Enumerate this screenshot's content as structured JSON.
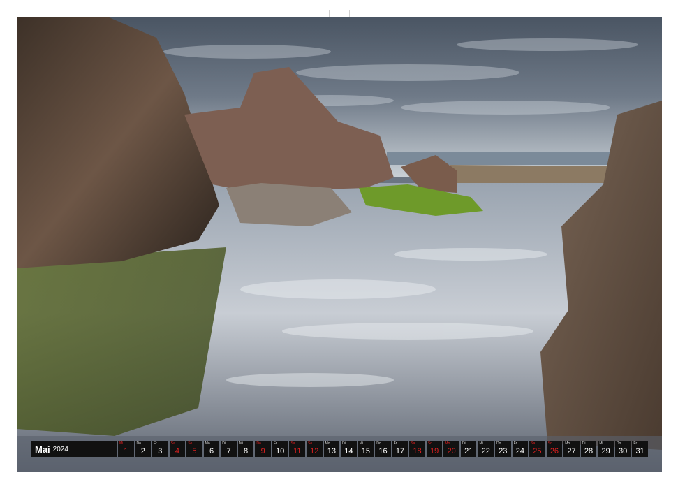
{
  "calendar": {
    "month": "Mai",
    "year": "2024",
    "days": [
      {
        "wd": "Mi",
        "num": "1",
        "red": true
      },
      {
        "wd": "Do",
        "num": "2",
        "red": false
      },
      {
        "wd": "Fr",
        "num": "3",
        "red": false
      },
      {
        "wd": "Sa",
        "num": "4",
        "red": true
      },
      {
        "wd": "So",
        "num": "5",
        "red": true
      },
      {
        "wd": "Mo",
        "num": "6",
        "red": false
      },
      {
        "wd": "Di",
        "num": "7",
        "red": false
      },
      {
        "wd": "Mi",
        "num": "8",
        "red": false
      },
      {
        "wd": "Do",
        "num": "9",
        "red": true
      },
      {
        "wd": "Fr",
        "num": "10",
        "red": false
      },
      {
        "wd": "Sa",
        "num": "11",
        "red": true
      },
      {
        "wd": "So",
        "num": "12",
        "red": true
      },
      {
        "wd": "Mo",
        "num": "13",
        "red": false
      },
      {
        "wd": "Di",
        "num": "14",
        "red": false
      },
      {
        "wd": "Mi",
        "num": "15",
        "red": false
      },
      {
        "wd": "Do",
        "num": "16",
        "red": false
      },
      {
        "wd": "Fr",
        "num": "17",
        "red": false
      },
      {
        "wd": "Sa",
        "num": "18",
        "red": true
      },
      {
        "wd": "So",
        "num": "19",
        "red": true
      },
      {
        "wd": "Mo",
        "num": "20",
        "red": true
      },
      {
        "wd": "Di",
        "num": "21",
        "red": false
      },
      {
        "wd": "Mi",
        "num": "22",
        "red": false
      },
      {
        "wd": "Do",
        "num": "23",
        "red": false
      },
      {
        "wd": "Fr",
        "num": "24",
        "red": false
      },
      {
        "wd": "Sa",
        "num": "25",
        "red": true
      },
      {
        "wd": "So",
        "num": "26",
        "red": true
      },
      {
        "wd": "Mo",
        "num": "27",
        "red": false
      },
      {
        "wd": "Di",
        "num": "28",
        "red": false
      },
      {
        "wd": "Mi",
        "num": "29",
        "red": false
      },
      {
        "wd": "Do",
        "num": "30",
        "red": false
      },
      {
        "wd": "Fr",
        "num": "31",
        "red": false
      }
    ]
  },
  "colors": {
    "bar": "#111111",
    "holiday": "#e02020",
    "sky": "#5f6b7a",
    "water": "#8a95a3",
    "rock": "#6e5a4c",
    "moss": "#6d8f2a"
  }
}
